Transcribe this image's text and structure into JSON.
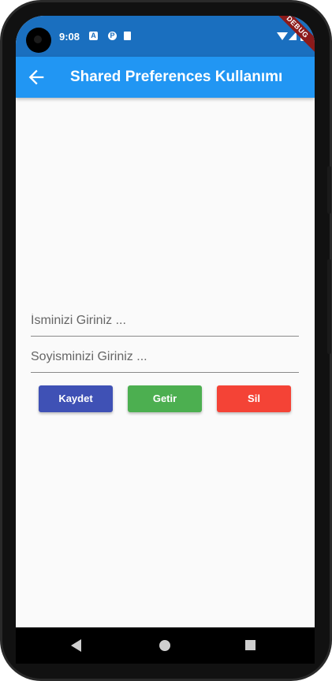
{
  "status_bar": {
    "time": "9:08",
    "debug_label": "DEBUG",
    "icons": [
      "a-notification-icon",
      "p-notification-icon",
      "sd-card-icon",
      "wifi-icon",
      "signal-icon",
      "battery-icon"
    ]
  },
  "app_bar": {
    "title": "Shared Preferences Kullanımı",
    "back_icon": "arrow-back-icon"
  },
  "form": {
    "name_placeholder": "İsminizi Giriniz ...",
    "name_value": "",
    "surname_placeholder": "Soyisminizi Giriniz ...",
    "surname_value": ""
  },
  "buttons": {
    "save_label": "Kaydet",
    "get_label": "Getir",
    "delete_label": "Sil"
  },
  "colors": {
    "status_bar": "#1a6fbf",
    "app_bar": "#2196f3",
    "save_button": "#3f51b5",
    "get_button": "#4caf50",
    "delete_button": "#f44336",
    "background": "#fafafa"
  },
  "nav_bar": {
    "icons": [
      "nav-back-icon",
      "nav-home-icon",
      "nav-recents-icon"
    ]
  }
}
